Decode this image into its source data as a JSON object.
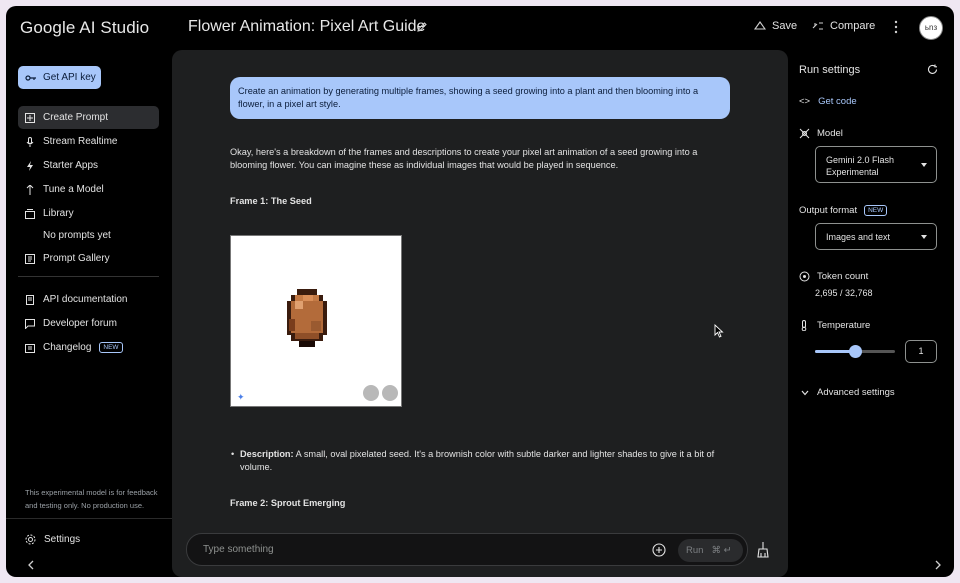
{
  "header": {
    "brand": "Google AI Studio",
    "title": "Flower Animation: Pixel Art Guide",
    "save_label": "Save",
    "compare_label": "Compare",
    "avatar_text": "ьnз"
  },
  "sidebar": {
    "api_key_label": "Get API key",
    "items": [
      {
        "label": "Create Prompt",
        "icon": "create-prompt-icon"
      },
      {
        "label": "Stream Realtime",
        "icon": "mic-icon"
      },
      {
        "label": "Starter Apps",
        "icon": "bolt-icon"
      },
      {
        "label": "Tune a Model",
        "icon": "tune-icon"
      },
      {
        "label": "Library",
        "icon": "library-icon"
      }
    ],
    "library_empty": "No prompts yet",
    "gallery_label": "Prompt Gallery",
    "links": [
      {
        "label": "API documentation",
        "icon": "docs-icon"
      },
      {
        "label": "Developer forum",
        "icon": "forum-icon"
      },
      {
        "label": "Changelog",
        "icon": "changelog-icon",
        "badge": "NEW"
      }
    ],
    "disclaimer": "This experimental model is for feedback and testing only. No production use.",
    "settings_label": "Settings"
  },
  "chat": {
    "user_prompt": "Create an animation by generating multiple frames, showing a seed growing into a plant and then blooming into a flower, in a pixel art style.",
    "response_intro": "Okay, here's a breakdown of the frames and descriptions to create your pixel art animation of a seed growing into a blooming flower. You can imagine these as individual images that would be played in sequence.",
    "frame1_title": "Frame 1: The Seed",
    "desc_label": "Description:",
    "desc_text": " A small, oval pixelated seed. It's a brownish color with subtle darker and lighter shades to give it a bit of volume.",
    "frame2_title": "Frame 2: Sprout Emerging",
    "input_placeholder": "Type something",
    "run_label": "Run",
    "run_shortcut": "⌘ ↵"
  },
  "run_settings": {
    "title": "Run settings",
    "get_code": "Get code",
    "model_label": "Model",
    "model_value_line1": "Gemini 2.0 Flash",
    "model_value_line2": "Experimental",
    "output_format_label": "Output format",
    "output_badge": "NEW",
    "output_value": "Images and text",
    "token_label": "Token count",
    "token_value": "2,695 / 32,768",
    "temperature_label": "Temperature",
    "temperature_value": "1",
    "temperature_fraction": 0.5,
    "advanced_label": "Advanced settings"
  },
  "colors": {
    "accent": "#a8c7fa",
    "background": "#000000",
    "panel": "#1e1f20"
  }
}
